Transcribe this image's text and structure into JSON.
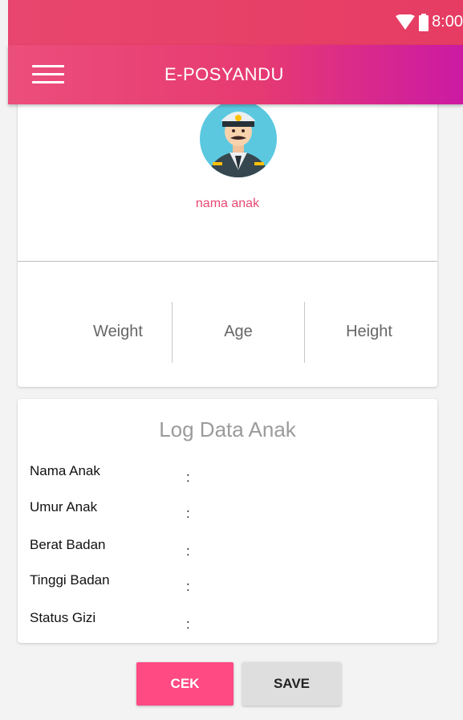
{
  "status_bar": {
    "time": "8:00"
  },
  "app_bar": {
    "title": "E-POSYANDU"
  },
  "profile": {
    "name": "nama anak",
    "stats": [
      {
        "label": "Weight"
      },
      {
        "label": "Age"
      },
      {
        "label": "Height"
      }
    ]
  },
  "log": {
    "title": "Log Data Anak",
    "rows": [
      {
        "label": "Nama Anak",
        "sep": ":"
      },
      {
        "label": "Umur Anak",
        "sep": ":"
      },
      {
        "label": "Berat Badan",
        "sep": ":"
      },
      {
        "label": "Tinggi Badan",
        "sep": ":"
      },
      {
        "label": "Status Gizi",
        "sep": ":"
      }
    ]
  },
  "buttons": {
    "cek": "CEK",
    "save": "SAVE"
  },
  "colors": {
    "accent": "#ff4a84",
    "status_bar": "#e8466e",
    "app_bar_gradient_end": "#cc1aa3",
    "name_text": "#e84a74"
  },
  "icons": [
    "wifi-icon",
    "battery-icon",
    "menu-icon",
    "avatar-captain"
  ]
}
